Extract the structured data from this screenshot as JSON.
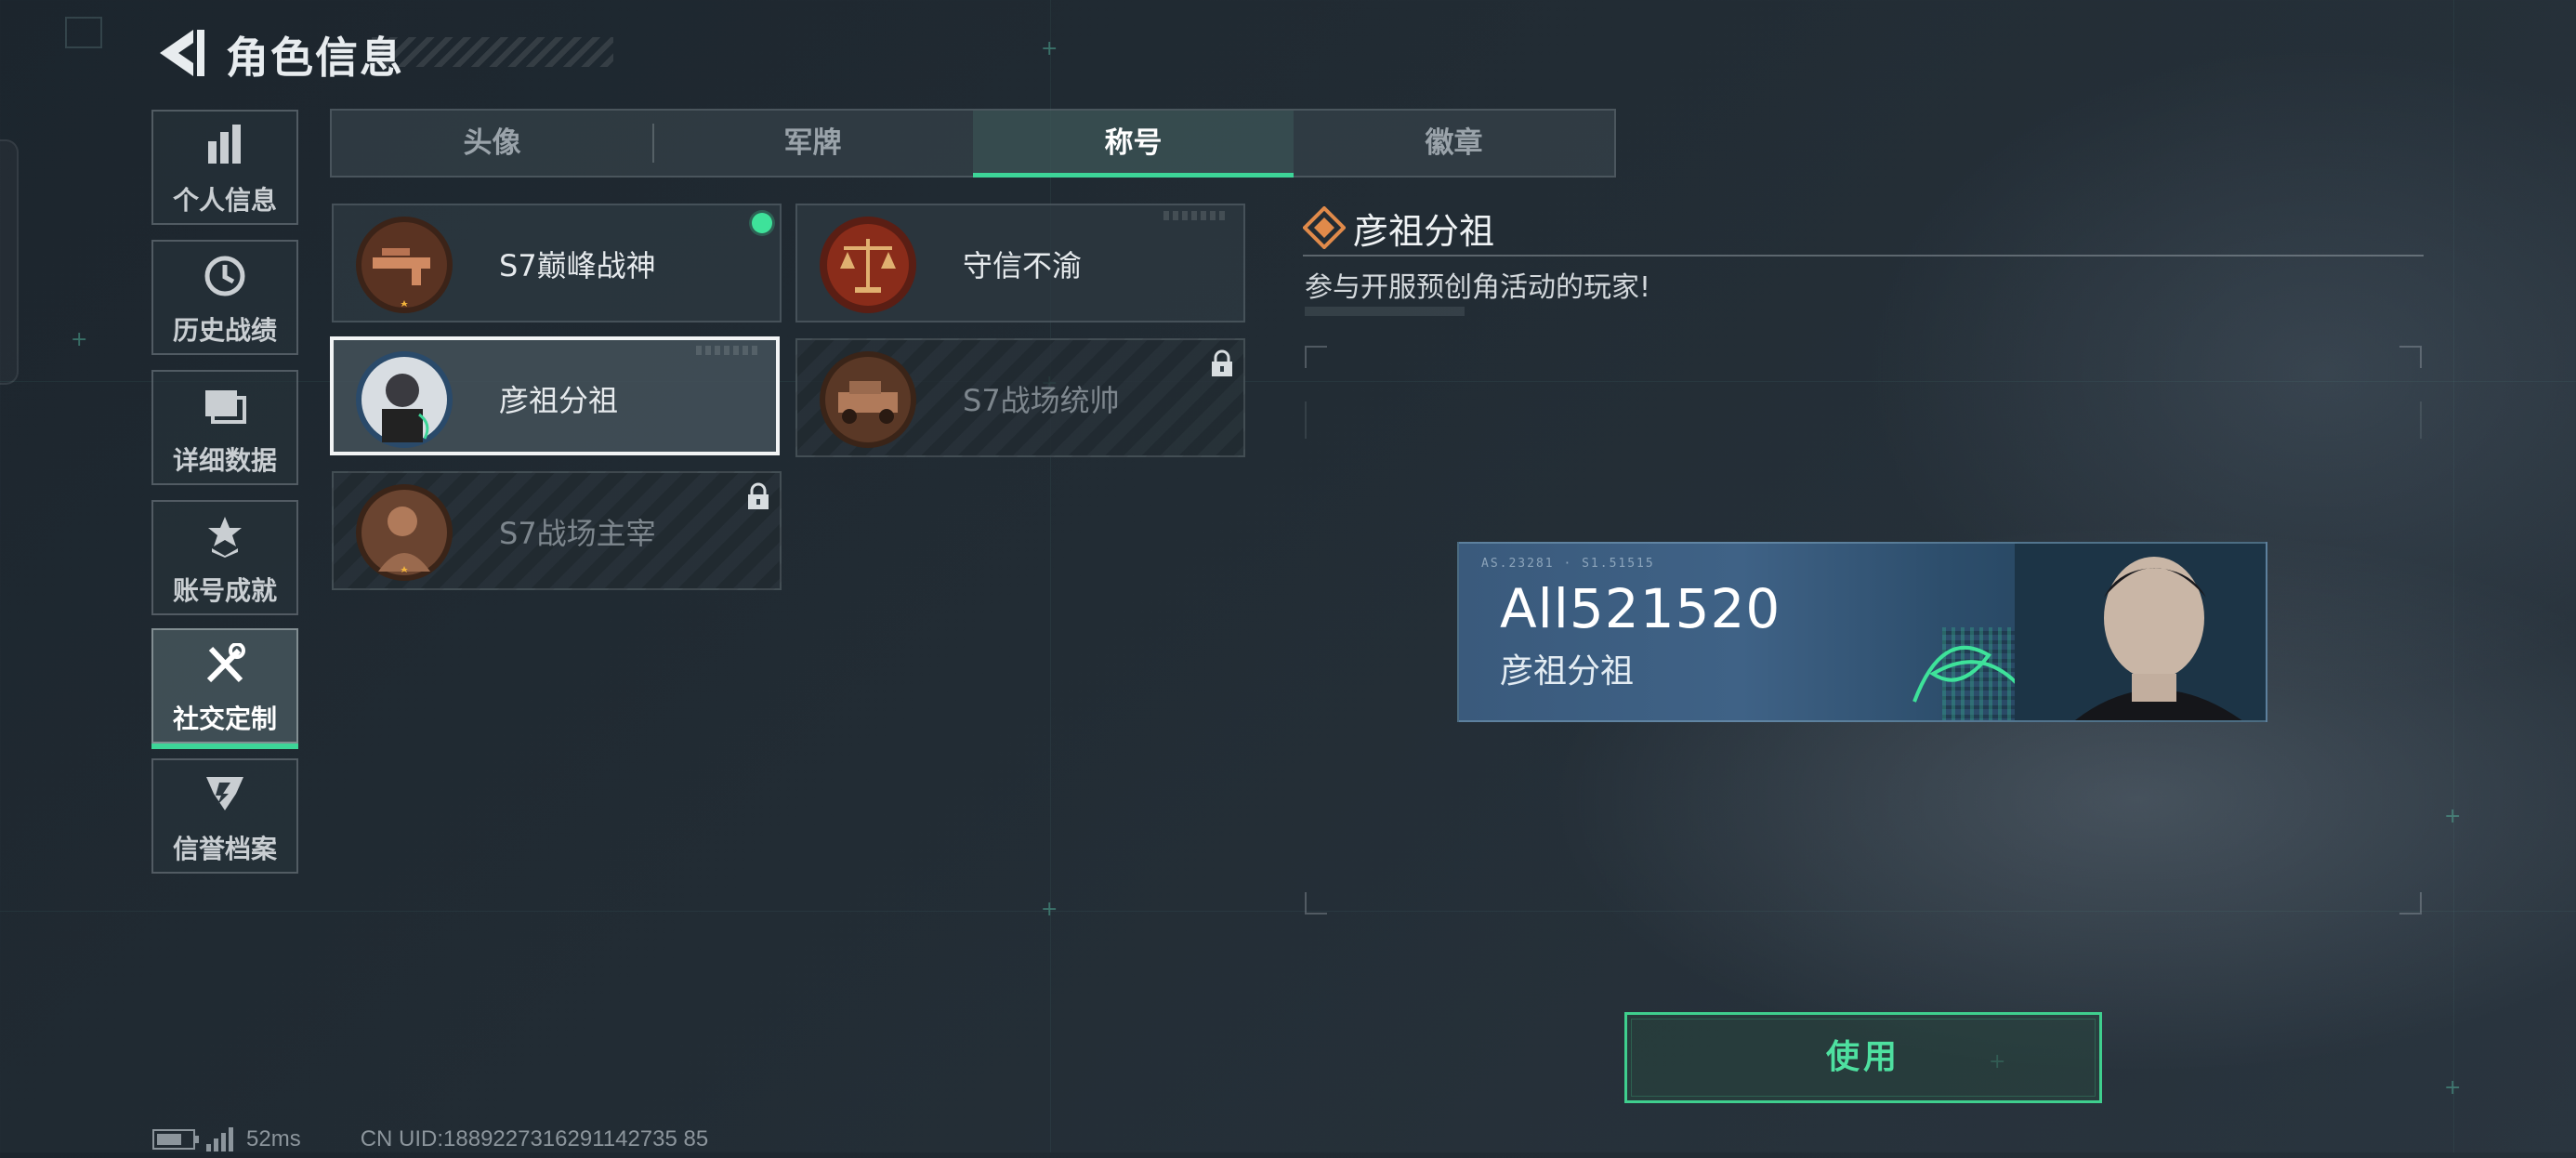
{
  "header": {
    "title": "角色信息",
    "back_icon": "back-arrow-icon"
  },
  "sidebar": {
    "items": [
      {
        "label": "个人信息",
        "icon": "bar-chart-icon",
        "active": false
      },
      {
        "label": "历史战绩",
        "icon": "clock-history-icon",
        "active": false
      },
      {
        "label": "详细数据",
        "icon": "folder-icon",
        "active": false
      },
      {
        "label": "账号成就",
        "icon": "medal-icon",
        "active": false
      },
      {
        "label": "社交定制",
        "icon": "tools-icon",
        "active": true
      },
      {
        "label": "信誉档案",
        "icon": "shield-icon",
        "active": false
      }
    ]
  },
  "tabs": [
    {
      "label": "头像",
      "active": false
    },
    {
      "label": "军牌",
      "active": false
    },
    {
      "label": "称号",
      "active": true
    },
    {
      "label": "徽章",
      "active": false
    }
  ],
  "titles": [
    {
      "name": "S7巅峰战神",
      "status": "equipped",
      "emblem": "weapon-emblem-icon"
    },
    {
      "name": "守信不渝",
      "status": "owned",
      "emblem": "scales-emblem-icon"
    },
    {
      "name": "彦祖分祖",
      "status": "selected",
      "emblem": "portrait-emblem-icon"
    },
    {
      "name": "S7战场统帅",
      "status": "locked",
      "emblem": "vehicle-emblem-icon"
    },
    {
      "name": "S7战场主宰",
      "status": "locked",
      "emblem": "soldier-emblem-icon"
    }
  ],
  "detail": {
    "title": "彦祖分祖",
    "description": "参与开服预创角活动的玩家!",
    "nameplate": {
      "player_id": "All521520",
      "title": "彦祖分祖"
    }
  },
  "actions": {
    "use_label": "使用"
  },
  "status_bar": {
    "ping": "52ms",
    "uid": "CN UID:1889227316291142735 85"
  },
  "colors": {
    "accent": "#3dd598",
    "equipped_dot": "#3ee29a",
    "detail_icon": "#e08a4a"
  }
}
